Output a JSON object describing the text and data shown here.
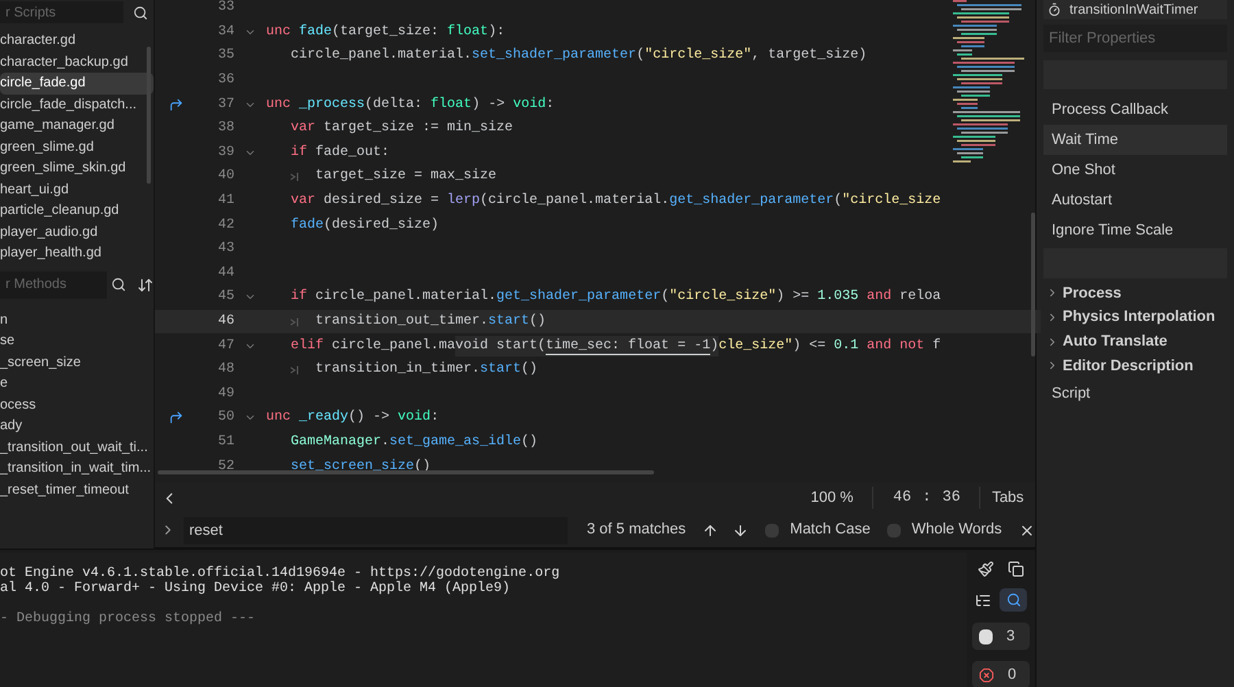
{
  "scripts_panel": {
    "filter": {
      "placeholder": "r Scripts"
    },
    "items": [
      {
        "label": "character.gd",
        "selected": false
      },
      {
        "label": "character_backup.gd",
        "selected": false
      },
      {
        "label": "circle_fade.gd",
        "selected": true
      },
      {
        "label": "circle_fade_dispatch...",
        "selected": false
      },
      {
        "label": "game_manager.gd",
        "selected": false
      },
      {
        "label": "green_slime.gd",
        "selected": false
      },
      {
        "label": "green_slime_skin.gd",
        "selected": false
      },
      {
        "label": "heart_ui.gd",
        "selected": false
      },
      {
        "label": "particle_cleanup.gd",
        "selected": false
      },
      {
        "label": "player_audio.gd",
        "selected": false
      },
      {
        "label": "player_health.gd",
        "selected": false
      }
    ]
  },
  "methods_panel": {
    "filter": {
      "placeholder": "r Methods"
    },
    "items": [
      "n",
      "se",
      "_screen_size",
      "e",
      "ocess",
      "ady",
      "_transition_out_wait_ti...",
      "_transition_in_wait_tim...",
      "_reset_timer_timeout"
    ]
  },
  "editor": {
    "lines": [
      {
        "num": "33",
        "fold": false,
        "override": false,
        "current": false
      },
      {
        "num": "34",
        "fold": true,
        "override": false,
        "current": false,
        "tokens": [
          {
            "kind": "text",
            "t": "unc ",
            "color": "#ff7085"
          },
          {
            "kind": "text",
            "t": "fade",
            "color": "#66e6ff"
          },
          {
            "kind": "text",
            "t": "(target_size: ",
            "color": "#cdcfd2"
          },
          {
            "kind": "text",
            "t": "float",
            "color": "#42ffc2"
          },
          {
            "kind": "text",
            "t": "):",
            "color": "#cdcfd2"
          }
        ]
      },
      {
        "num": "35",
        "fold": false,
        "override": false,
        "current": false,
        "indent": [
          {
            "marker": false
          }
        ],
        "tokens": [
          {
            "kind": "text",
            "t": "circle_panel.material.",
            "color": "#cdcfd2"
          },
          {
            "kind": "text",
            "t": "set_shader_parameter",
            "color": "#57b3ff"
          },
          {
            "kind": "text",
            "t": "(",
            "color": "#cdcfd2"
          },
          {
            "kind": "text",
            "t": "\"circle_size\"",
            "color": "#ffeda1"
          },
          {
            "kind": "text",
            "t": ", target_size)",
            "color": "#cdcfd2"
          }
        ]
      },
      {
        "num": "36",
        "fold": false,
        "override": false,
        "current": false
      },
      {
        "num": "37",
        "fold": true,
        "override": true,
        "current": false,
        "tokens": [
          {
            "kind": "text",
            "t": "unc ",
            "color": "#ff7085"
          },
          {
            "kind": "text",
            "t": "_process",
            "color": "#66e6ff"
          },
          {
            "kind": "text",
            "t": "(delta: ",
            "color": "#cdcfd2"
          },
          {
            "kind": "text",
            "t": "float",
            "color": "#42ffc2"
          },
          {
            "kind": "text",
            "t": ") -> ",
            "color": "#cdcfd2"
          },
          {
            "kind": "text",
            "t": "void",
            "color": "#42ffc2"
          },
          {
            "kind": "text",
            "t": ":",
            "color": "#cdcfd2"
          }
        ]
      },
      {
        "num": "38",
        "fold": false,
        "override": false,
        "current": false,
        "indent": [
          {
            "marker": false
          }
        ],
        "tokens": [
          {
            "kind": "text",
            "t": "var",
            "color": "#ff7085"
          },
          {
            "kind": "text",
            "t": " target_size := min_size",
            "color": "#cdcfd2"
          }
        ]
      },
      {
        "num": "39",
        "fold": true,
        "override": false,
        "current": false,
        "indent": [
          {
            "marker": false
          }
        ],
        "tokens": [
          {
            "kind": "text",
            "t": "if",
            "color": "#ff7085"
          },
          {
            "kind": "text",
            "t": " fade_out:",
            "color": "#cdcfd2"
          }
        ]
      },
      {
        "num": "40",
        "fold": false,
        "override": false,
        "current": false,
        "indent": [
          {
            "marker": false
          },
          {
            "marker": true
          }
        ],
        "tokens": [
          {
            "kind": "text",
            "t": "target_size = max_size",
            "color": "#cdcfd2"
          }
        ]
      },
      {
        "num": "41",
        "fold": false,
        "override": false,
        "current": false,
        "indent": [
          {
            "marker": false
          }
        ],
        "tokens": [
          {
            "kind": "text",
            "t": "var",
            "color": "#ff7085"
          },
          {
            "kind": "text",
            "t": " desired_size = ",
            "color": "#cdcfd2"
          },
          {
            "kind": "text",
            "t": "lerp",
            "color": "#a3a3f5"
          },
          {
            "kind": "text",
            "t": "(circle_panel.material.",
            "color": "#cdcfd2"
          },
          {
            "kind": "text",
            "t": "get_shader_parameter",
            "color": "#57b3ff"
          },
          {
            "kind": "text",
            "t": "(",
            "color": "#cdcfd2"
          },
          {
            "kind": "text",
            "t": "\"circle_size",
            "color": "#ffeda1"
          }
        ]
      },
      {
        "num": "42",
        "fold": false,
        "override": false,
        "current": false,
        "indent": [
          {
            "marker": false
          }
        ],
        "tokens": [
          {
            "kind": "text",
            "t": "fade",
            "color": "#57b3ff"
          },
          {
            "kind": "text",
            "t": "(desired_size)",
            "color": "#cdcfd2"
          }
        ]
      },
      {
        "num": "43",
        "fold": false,
        "override": false,
        "current": false
      },
      {
        "num": "44",
        "fold": false,
        "override": false,
        "current": false
      },
      {
        "num": "45",
        "fold": true,
        "override": false,
        "current": false,
        "indent": [
          {
            "marker": false
          }
        ],
        "tokens": [
          {
            "kind": "text",
            "t": "if",
            "color": "#ff7085"
          },
          {
            "kind": "text",
            "t": " circle_panel.material.",
            "color": "#cdcfd2"
          },
          {
            "kind": "text",
            "t": "get_shader_parameter",
            "color": "#57b3ff"
          },
          {
            "kind": "text",
            "t": "(",
            "color": "#cdcfd2"
          },
          {
            "kind": "text",
            "t": "\"circle_size\"",
            "color": "#ffeda1"
          },
          {
            "kind": "text",
            "t": ") >= ",
            "color": "#cdcfd2"
          },
          {
            "kind": "text",
            "t": "1.035",
            "color": "#a1ffe0"
          },
          {
            "kind": "text",
            "t": " and",
            "color": "#ff7085"
          },
          {
            "kind": "text",
            "t": " reloa",
            "color": "#cdcfd2"
          }
        ]
      },
      {
        "num": "46",
        "fold": false,
        "override": false,
        "current": true,
        "indent": [
          {
            "marker": false
          },
          {
            "marker": true
          }
        ],
        "tokens": [
          {
            "kind": "text",
            "t": "transition_out_timer.",
            "color": "#cdcfd2"
          },
          {
            "kind": "text",
            "t": "start",
            "color": "#57b3ff"
          },
          {
            "kind": "text",
            "t": "()",
            "color": "#cdcfd2"
          }
        ]
      },
      {
        "num": "47",
        "fold": true,
        "override": false,
        "current": false,
        "indent": [
          {
            "marker": false
          }
        ],
        "tokens": [
          {
            "kind": "text",
            "t": "elif",
            "color": "#ff7085"
          },
          {
            "kind": "text",
            "t": " circle_panel.ma",
            "color": "#cdcfd2"
          },
          {
            "kind": "tooltip",
            "before": "void start(",
            "arg": "time_sec: float = -1",
            "after": ")"
          },
          {
            "kind": "text",
            "t": "cle_size\"",
            "color": "#ffeda1"
          },
          {
            "kind": "text",
            "t": ") <= ",
            "color": "#cdcfd2"
          },
          {
            "kind": "text",
            "t": "0.1",
            "color": "#a1ffe0"
          },
          {
            "kind": "text",
            "t": " and not",
            "color": "#ff7085"
          },
          {
            "kind": "text",
            "t": " f",
            "color": "#cdcfd2"
          }
        ]
      },
      {
        "num": "48",
        "fold": false,
        "override": false,
        "current": false,
        "indent": [
          {
            "marker": false
          },
          {
            "marker": true
          }
        ],
        "tokens": [
          {
            "kind": "text",
            "t": "transition_in_timer.",
            "color": "#cdcfd2"
          },
          {
            "kind": "text",
            "t": "start",
            "color": "#57b3ff"
          },
          {
            "kind": "text",
            "t": "()",
            "color": "#cdcfd2"
          }
        ]
      },
      {
        "num": "49",
        "fold": false,
        "override": false,
        "current": false
      },
      {
        "num": "50",
        "fold": true,
        "override": true,
        "current": false,
        "tokens": [
          {
            "kind": "text",
            "t": "unc ",
            "color": "#ff7085"
          },
          {
            "kind": "text",
            "t": "_ready",
            "color": "#66e6ff"
          },
          {
            "kind": "text",
            "t": "() -> ",
            "color": "#cdcfd2"
          },
          {
            "kind": "text",
            "t": "void",
            "color": "#42ffc2"
          },
          {
            "kind": "text",
            "t": ":",
            "color": "#cdcfd2"
          }
        ]
      },
      {
        "num": "51",
        "fold": false,
        "override": false,
        "current": false,
        "indent": [
          {
            "marker": false
          }
        ],
        "tokens": [
          {
            "kind": "text",
            "t": "GameManager",
            "color": "#8effda"
          },
          {
            "kind": "text",
            "t": ".",
            "color": "#cdcfd2"
          },
          {
            "kind": "text",
            "t": "set_game_as_idle",
            "color": "#57b3ff"
          },
          {
            "kind": "text",
            "t": "()",
            "color": "#cdcfd2"
          }
        ]
      },
      {
        "num": "52",
        "fold": false,
        "override": false,
        "current": false,
        "indent": [
          {
            "marker": false
          }
        ],
        "tokens": [
          {
            "kind": "text",
            "t": "set_screen_size",
            "color": "#57b3ff"
          },
          {
            "kind": "text",
            "t": "()",
            "color": "#cdcfd2"
          }
        ]
      }
    ],
    "status": {
      "zoom": "100 %",
      "line": "46",
      "sep": ":",
      "column": "36",
      "indent_mode": "Tabs"
    },
    "find_bar": {
      "value": "reset",
      "matches": "3 of 5 matches",
      "options": [
        {
          "label": "Match Case",
          "checked": false
        },
        {
          "label": "Whole Words",
          "checked": false
        }
      ]
    }
  },
  "console": {
    "lines": [
      {
        "text": "ot Engine v4.6.1.stable.official.14d19694e - https://godotengine.org",
        "dim": false
      },
      {
        "text": "al 4.0 - Forward+ - Using Device #0: Apple - Apple M4 (Apple9)",
        "dim": false
      },
      {
        "text": "- Debugging process stopped ---",
        "dim": true
      }
    ],
    "search_on": true,
    "warnings": "3",
    "errors": "0"
  },
  "inspector": {
    "node": "transitionInWaitTimer",
    "filter": {
      "placeholder": "Filter Properties"
    },
    "properties": [
      {
        "kind": "property",
        "label": "Process Callback",
        "highlighted": false
      },
      {
        "kind": "property",
        "label": "Wait Time",
        "highlighted": true
      },
      {
        "kind": "property",
        "label": "One Shot",
        "highlighted": false
      },
      {
        "kind": "property",
        "label": "Autostart",
        "highlighted": false
      },
      {
        "kind": "property",
        "label": "Ignore Time Scale",
        "highlighted": false
      },
      {
        "kind": "spacer"
      },
      {
        "kind": "section",
        "label": "Process",
        "expanded": false
      },
      {
        "kind": "section",
        "label": "Physics Interpolation",
        "expanded": false
      },
      {
        "kind": "section",
        "label": "Auto Translate",
        "expanded": false
      },
      {
        "kind": "section",
        "label": "Editor Description",
        "expanded": false
      },
      {
        "kind": "property",
        "label": "Script",
        "highlighted": false
      }
    ]
  }
}
